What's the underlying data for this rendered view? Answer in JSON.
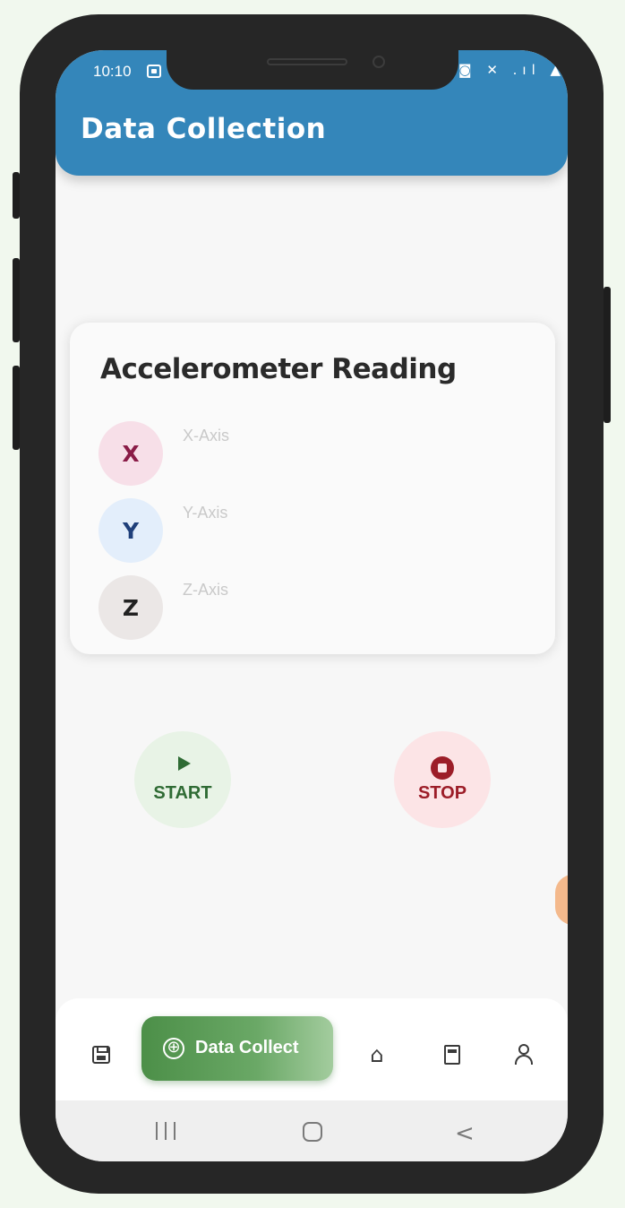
{
  "status_bar": {
    "time": "10:10",
    "right_icons": "◙ ✕ .ıl ▲"
  },
  "app_bar": {
    "title": "Data Collection"
  },
  "card": {
    "title": "Accelerometer Reading",
    "axes": [
      {
        "letter": "X",
        "label": "X-Axis",
        "bg": "#f7dfe8",
        "color": "#8a1c47"
      },
      {
        "letter": "Y",
        "label": "Y-Axis",
        "bg": "#e3eefb",
        "color": "#1f3f7a"
      },
      {
        "letter": "Z",
        "label": "Z-Axis",
        "bg": "#ebe7e6",
        "color": "#222222"
      }
    ]
  },
  "controls": {
    "start_label": "START",
    "stop_label": "STOP"
  },
  "bottom_nav": {
    "active_label": "Data Collect",
    "active_icon": "⊕",
    "items": [
      "save-icon",
      "data-collect-button",
      "home-icon",
      "document-icon",
      "profile-icon"
    ]
  },
  "colors": {
    "app_bar": "#3486ba",
    "start": "#2f6b34",
    "stop": "#9c1d28",
    "active_nav": "#5b9c57"
  }
}
